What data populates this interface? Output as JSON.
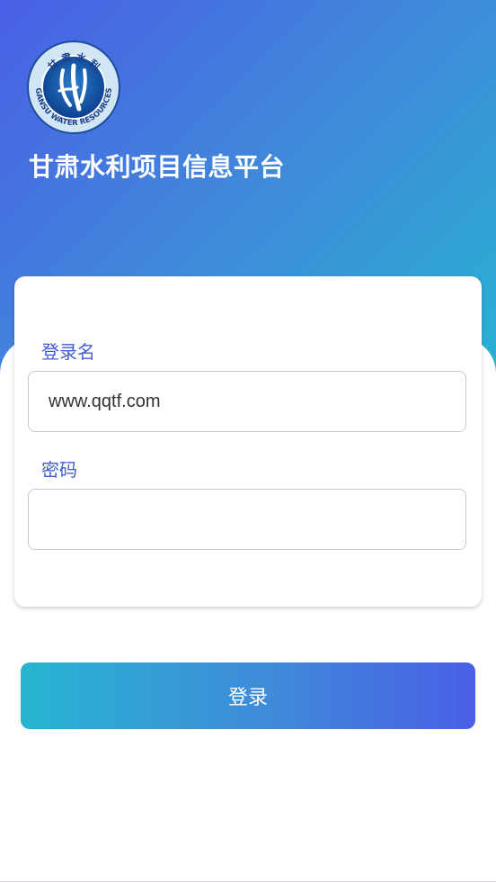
{
  "app": {
    "title": "甘肃水利项目信息平台",
    "logo": {
      "text_top": "甘 肃 水 利",
      "text_bottom": "GANSU WATER RESOURCES"
    }
  },
  "form": {
    "username_label": "登录名",
    "username_value": "www.qqtf.com",
    "password_label": "密码",
    "password_value": ""
  },
  "actions": {
    "login_label": "登录"
  },
  "colors": {
    "gradient_start": "#4a5fe6",
    "gradient_end": "#27b5d2",
    "label_color": "#3f5ed4"
  }
}
